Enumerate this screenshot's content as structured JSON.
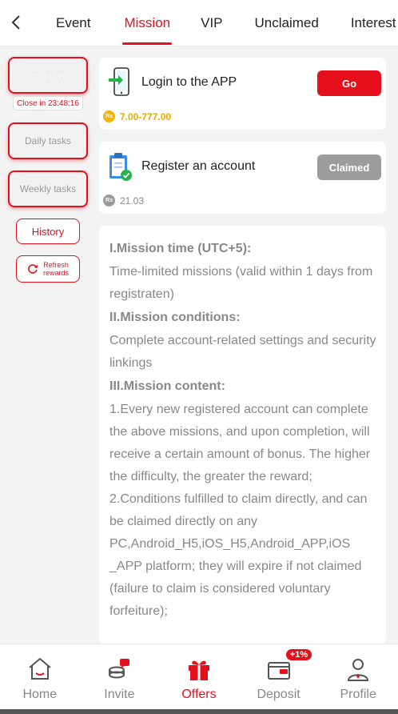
{
  "header": {
    "tabs": [
      {
        "label": "Event",
        "active": false
      },
      {
        "label": "Mission",
        "active": true
      },
      {
        "label": "VIP",
        "active": false
      },
      {
        "label": "Unclaimed",
        "active": false
      },
      {
        "label": "Interest",
        "active": false
      }
    ]
  },
  "sidebar": {
    "newplayer_label": "Newplayer",
    "countdown": "Close in 23:48:16",
    "daily_label": "Daily tasks",
    "weekly_label": "Weekly tasks",
    "history_label": "History",
    "refresh_line1": "Refresh",
    "refresh_line2": "rewards"
  },
  "missions": [
    {
      "title": "Login to the APP",
      "button": "Go",
      "reward_currency": "Rs",
      "reward": "7.00-777.00",
      "status": "go"
    },
    {
      "title": "Register an account",
      "button": "Claimed",
      "reward_currency": "Rs",
      "reward": "21.03",
      "status": "claimed"
    }
  ],
  "rules": {
    "h1": "I.Mission time (UTC+5):",
    "p1": "Time-limited missions (valid within 1 days from registraten)",
    "h2": "II.Mission conditions:",
    "p2": "Complete account-related settings and security linkings",
    "h3": "III.Mission content:",
    "p3": "1.Every new registered account can complete the above missions, and upon completion, will receive a certain amount of bonus. The higher the difficulty, the greater the reward;",
    "p4": "2.Conditions fulfilled to claim directly, and can be claimed directly on any PC,Android_H5,iOS_H5,Android_APP,iOS _APP platform; they will expire if not claimed (failure to claim is considered voluntary forfeiture);"
  },
  "bottom_nav": {
    "items": [
      {
        "label": "Home",
        "icon": "home-icon"
      },
      {
        "label": "Invite",
        "icon": "invite-icon"
      },
      {
        "label": "Offers",
        "icon": "gift-icon",
        "active": true
      },
      {
        "label": "Deposit",
        "icon": "wallet-icon",
        "badge": "+1%"
      },
      {
        "label": "Profile",
        "icon": "profile-icon"
      }
    ]
  },
  "colors": {
    "accent": "#e60f1c",
    "gold": "#f0a800",
    "muted": "#888888",
    "claimed": "#9c9c9c"
  }
}
